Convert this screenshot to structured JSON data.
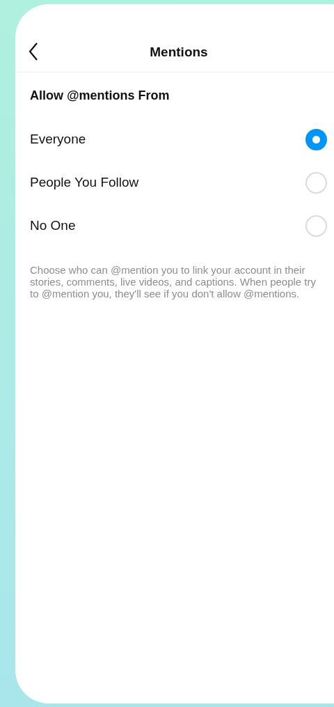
{
  "header": {
    "title": "Mentions"
  },
  "section": {
    "title": "Allow @mentions From"
  },
  "options": [
    {
      "label": "Everyone",
      "selected": true
    },
    {
      "label": "People You Follow",
      "selected": false
    },
    {
      "label": "No One",
      "selected": false
    }
  ],
  "description": "Choose who can @mention you to link your account in their stories, comments, live videos, and captions. When people try to @mention you, they'll see if you don't allow @mentions."
}
